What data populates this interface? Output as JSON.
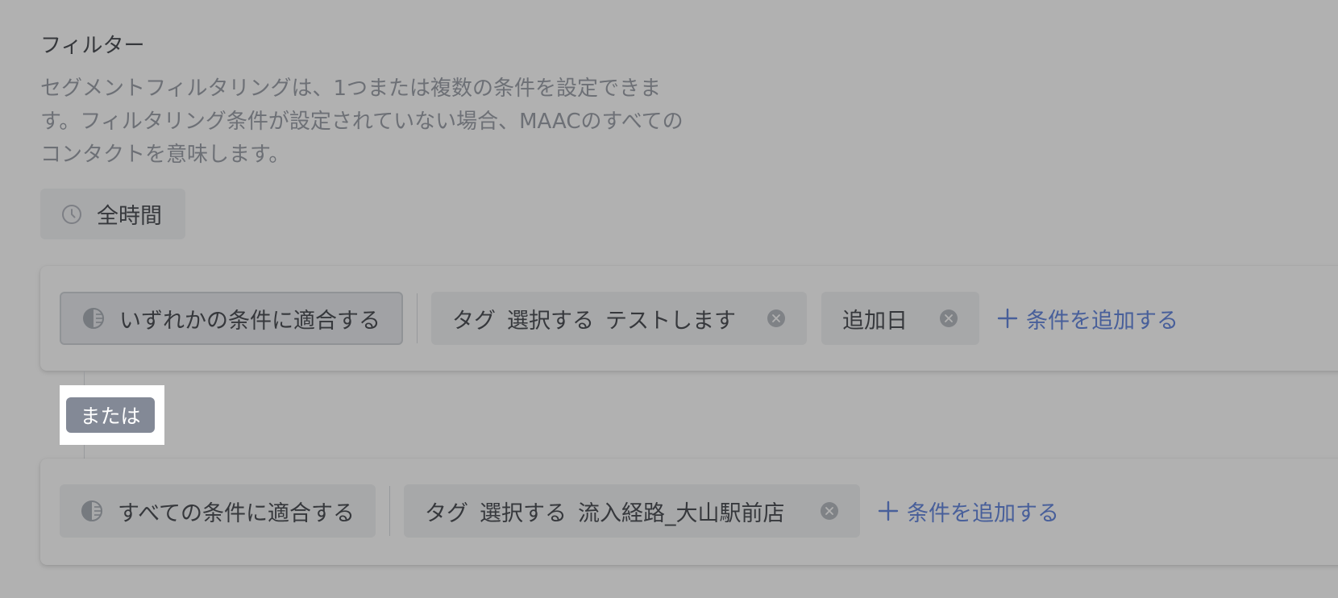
{
  "filter": {
    "title": "フィルター",
    "description": "セグメントフィルタリングは、1つまたは複数の条件を設定できます。フィルタリング条件が設定されていない場合、MAACのすべてのコンタクトを意味します。",
    "time_range_label": "全時間",
    "or_label": "または"
  },
  "groups": [
    {
      "match_label": "いずれかの条件に適合する",
      "conditions": [
        {
          "type": "タグ",
          "operator": "選択する",
          "value": "テストします"
        },
        {
          "type": "追加日"
        }
      ],
      "add_condition_label": "条件を追加する"
    },
    {
      "match_label": "すべての条件に適合する",
      "conditions": [
        {
          "type": "タグ",
          "operator": "選択する",
          "value": "流入経路_大山駅前店"
        }
      ],
      "add_condition_label": "条件を追加する"
    }
  ],
  "icons": {
    "time": "clock-icon",
    "match": "half-circle-icon",
    "clear": "clear-circle-icon",
    "add": "plus-icon"
  },
  "colors": {
    "accent_link": "#4a73d8",
    "or_badge_bg": "#838996",
    "overlay": "rgba(70,70,70,0.42)"
  }
}
